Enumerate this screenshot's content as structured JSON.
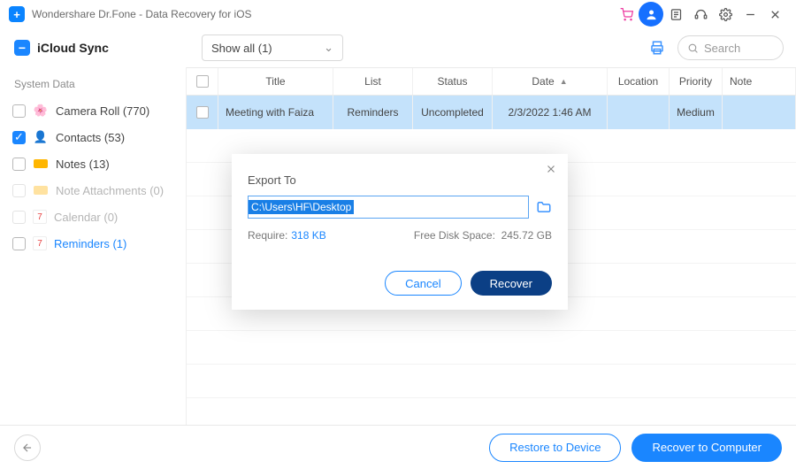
{
  "window": {
    "title": "Wondershare Dr.Fone - Data Recovery for iOS"
  },
  "side_head": "iCloud Sync",
  "toolbar": {
    "filter_label": "Show all (1)",
    "search_placeholder": "Search"
  },
  "sidebar": {
    "group": "System Data",
    "items": [
      {
        "label": "Camera Roll (770)",
        "checked": false,
        "disabled": false
      },
      {
        "label": "Contacts (53)",
        "checked": true,
        "disabled": false
      },
      {
        "label": "Notes (13)",
        "checked": false,
        "disabled": false
      },
      {
        "label": "Note Attachments (0)",
        "checked": false,
        "disabled": true
      },
      {
        "label": "Calendar (0)",
        "checked": false,
        "disabled": true
      },
      {
        "label": "Reminders (1)",
        "checked": false,
        "disabled": false,
        "selected": true
      }
    ]
  },
  "table": {
    "headers": {
      "title": "Title",
      "list": "List",
      "status": "Status",
      "date": "Date",
      "location": "Location",
      "priority": "Priority",
      "note": "Note"
    },
    "row": {
      "title": "Meeting with Faiza",
      "list": "Reminders",
      "status": "Uncompleted",
      "date": "2/3/2022 1:46 AM",
      "location": "",
      "priority": "Medium",
      "note": ""
    }
  },
  "footer": {
    "restore": "Restore to Device",
    "recover": "Recover to Computer"
  },
  "modal": {
    "title": "Export To",
    "path": "C:\\Users\\HF\\Desktop",
    "require_label": "Require:",
    "require_value": "318 KB",
    "free_label": "Free Disk Space:",
    "free_value": "245.72 GB",
    "cancel": "Cancel",
    "recover": "Recover"
  }
}
